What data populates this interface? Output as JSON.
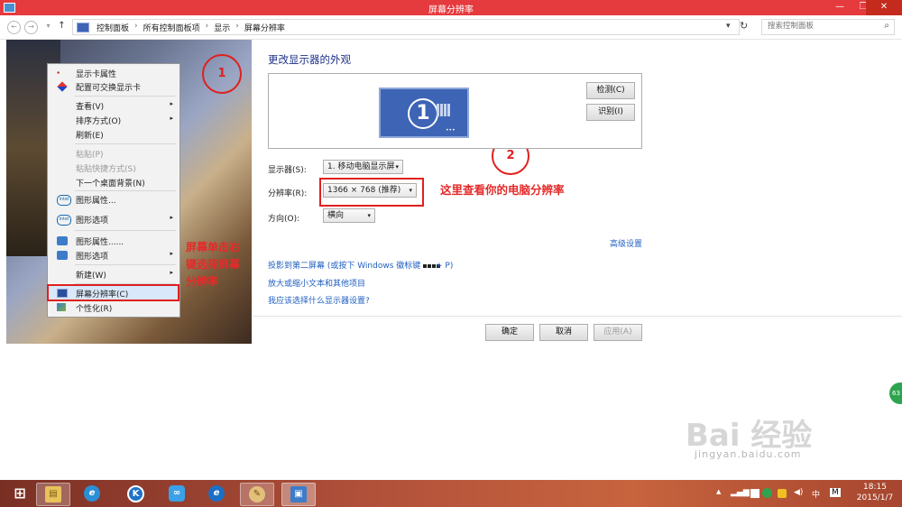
{
  "window": {
    "title": "屏幕分辨率",
    "buttons": {
      "minimize": "—",
      "maximize": "❐",
      "close": "✕"
    }
  },
  "address": {
    "nav": {
      "back": "←",
      "forward": "→",
      "up": "↑",
      "dropdown": "▾",
      "refresh": "↻"
    },
    "crumbs": [
      "控制面板",
      "所有控制面板项",
      "显示",
      "屏幕分辨率"
    ],
    "separator": "›",
    "search_placeholder": "搜索控制面板",
    "search_icon": "⌕"
  },
  "context_menu": {
    "items": [
      {
        "label": "显示卡属性",
        "icon": "graphics-card-icon"
      },
      {
        "label": "配置可交换显示卡",
        "icon": "switchable-graphics-icon"
      },
      {
        "label": "查看(V)",
        "arrow": "▸"
      },
      {
        "label": "排序方式(O)",
        "arrow": "▸"
      },
      {
        "label": "刷新(E)"
      },
      {
        "label": "粘贴(P)",
        "disabled": true
      },
      {
        "label": "粘贴快捷方式(S)",
        "disabled": true
      },
      {
        "label": "下一个桌面背景(N)"
      },
      {
        "label": "图形属性...",
        "icon": "intel-icon",
        "icon_text": "intel"
      },
      {
        "label": "图形选项",
        "icon": "intel-icon",
        "icon_text": "intel",
        "arrow": "▸"
      },
      {
        "label": "图形属性......",
        "icon": "graphics-icon"
      },
      {
        "label": "图形选项",
        "icon": "graphics-icon",
        "arrow": "▸"
      },
      {
        "label": "新建(W)",
        "arrow": "▸"
      },
      {
        "label": "屏幕分辨率(C)",
        "icon": "display-icon"
      },
      {
        "label": "个性化(R)",
        "icon": "personalize-icon"
      }
    ]
  },
  "annotations": {
    "circle1": "1",
    "circle2": "2",
    "left_note": [
      "屏幕单击右",
      "键选择屏幕",
      "分辨率"
    ],
    "right_note": "这里查看你的电脑分辨率"
  },
  "main": {
    "heading": "更改显示器的外观",
    "monitor_number": "1",
    "detect_button": "检测(C)",
    "identify_button": "识别(I)",
    "display_label": "显示器(S):",
    "display_value": "1. 移动电脑显示屏",
    "resolution_label": "分辨率(R):",
    "resolution_value": "1366 × 768 (推荐)",
    "orientation_label": "方向(O):",
    "orientation_value": "横向",
    "advanced_link": "高级设置",
    "project_link_prefix": "投影到第二屏幕 (或按下 Windows 徽标键",
    "project_link_suffix": "+ P)",
    "text_size_link": "放大或缩小文本和其他项目",
    "which_settings_link": "我应该选择什么显示器设置?",
    "ok_button": "确定",
    "cancel_button": "取消",
    "apply_button": "应用(A)"
  },
  "watermark": {
    "main": "Bai 经验",
    "sub": "jingyan.baidu.com"
  },
  "floating_badge": "63",
  "taskbar": {
    "apps": [
      {
        "name": "start-button",
        "glyph": "⊞"
      },
      {
        "name": "file-explorer-icon",
        "glyph": "▤"
      },
      {
        "name": "internet-explorer-icon",
        "glyph": "e"
      },
      {
        "name": "k-app-icon",
        "glyph": "K"
      },
      {
        "name": "cloud-app-icon",
        "glyph": "∞"
      },
      {
        "name": "browser-icon",
        "glyph": "e"
      },
      {
        "name": "paint-icon",
        "glyph": "✎"
      },
      {
        "name": "control-panel-icon",
        "glyph": "▣"
      }
    ],
    "tray": {
      "chevron": "▲",
      "input_lang": "中",
      "ime": "M"
    },
    "time": "18:15",
    "date": "2015/1/7"
  }
}
